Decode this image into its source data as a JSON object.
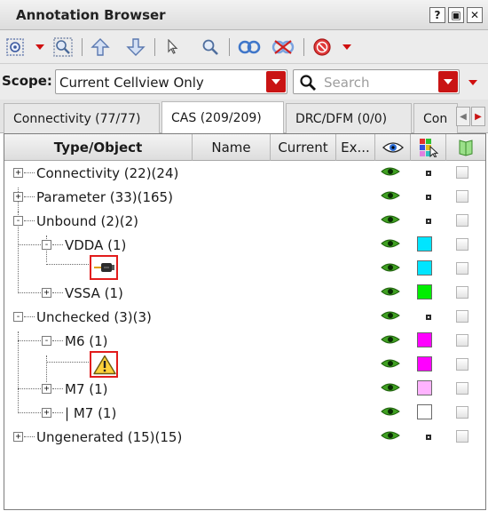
{
  "window": {
    "title": "Annotation Browser",
    "buttons": [
      "?",
      "▣",
      "✕"
    ]
  },
  "scope": {
    "label": "Scope:",
    "value": "Current Cellview Only",
    "search_placeholder": "Search"
  },
  "tabs": [
    {
      "label": "Connectivity (77/77)",
      "active": false
    },
    {
      "label": "CAS (209/209)",
      "active": true
    },
    {
      "label": "DRC/DFM (0/0)",
      "active": false
    },
    {
      "label": "Con",
      "active": false
    }
  ],
  "columns": {
    "type_object": "Type/Object",
    "name": "Name",
    "current": "Current",
    "expected": "Ex..."
  },
  "colors": {
    "accent_red": "#c91414",
    "eye_green": "#2a7a14",
    "cyan": "#00e5ff",
    "green": "#00ee00",
    "magenta": "#ff00ff",
    "pink": "#ffb3ff",
    "white": "#ffffff",
    "highlight": "#e21c1c"
  },
  "tree": [
    {
      "label": "Connectivity (22)(24)",
      "level": 0,
      "expander": "+",
      "marker": "small-square"
    },
    {
      "label": "Parameter (33)(165)",
      "level": 0,
      "expander": "+",
      "marker": "small-square"
    },
    {
      "label": "Unbound (2)(2)",
      "level": 0,
      "expander": "-",
      "marker": "small-square"
    },
    {
      "label": "VDDA (1)",
      "level": 1,
      "expander": "-",
      "marker": "swatch",
      "color": "#00e5ff"
    },
    {
      "label": "",
      "level": 2,
      "icon": "probe-icon",
      "marker": "swatch",
      "color": "#00e5ff"
    },
    {
      "label": "VSSA (1)",
      "level": 1,
      "expander": "+",
      "marker": "swatch",
      "color": "#00ee00"
    },
    {
      "label": "Unchecked (3)(3)",
      "level": 0,
      "expander": "-",
      "marker": "small-square"
    },
    {
      "label": "M6 (1)",
      "level": 1,
      "expander": "-",
      "marker": "swatch",
      "color": "#ff00ff"
    },
    {
      "label": "",
      "level": 2,
      "icon": "warning-icon",
      "marker": "swatch",
      "color": "#ff00ff"
    },
    {
      "label": "M7 (1)",
      "level": 1,
      "expander": "+",
      "marker": "swatch",
      "color": "#ffb3ff"
    },
    {
      "label": "| M7 (1)",
      "level": 1,
      "expander": "+",
      "marker": "swatch",
      "color": "#ffffff"
    },
    {
      "label": "Ungenerated (15)(15)",
      "level": 0,
      "expander": "+",
      "marker": "small-square"
    }
  ],
  "icons": {
    "toolbar": [
      "probe-tool-icon",
      "zoom-select-icon",
      "arrow-up-icon",
      "arrow-down-icon",
      "pointer-icon",
      "magnifier-icon",
      "link-icon",
      "unlink-icon",
      "stop-icon"
    ],
    "header": [
      "eye-icon",
      "color-grid-icon",
      "flag-icon"
    ]
  }
}
